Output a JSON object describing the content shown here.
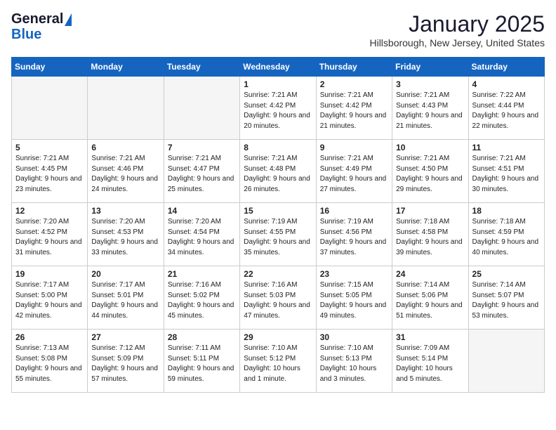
{
  "header": {
    "logo_line1": "General",
    "logo_line2": "Blue",
    "month": "January 2025",
    "location": "Hillsborough, New Jersey, United States"
  },
  "weekdays": [
    "Sunday",
    "Monday",
    "Tuesday",
    "Wednesday",
    "Thursday",
    "Friday",
    "Saturday"
  ],
  "weeks": [
    [
      {
        "day": "",
        "empty": true
      },
      {
        "day": "",
        "empty": true
      },
      {
        "day": "",
        "empty": true
      },
      {
        "day": "1",
        "sunrise": "7:21 AM",
        "sunset": "4:42 PM",
        "daylight": "9 hours and 20 minutes."
      },
      {
        "day": "2",
        "sunrise": "7:21 AM",
        "sunset": "4:42 PM",
        "daylight": "9 hours and 21 minutes."
      },
      {
        "day": "3",
        "sunrise": "7:21 AM",
        "sunset": "4:43 PM",
        "daylight": "9 hours and 21 minutes."
      },
      {
        "day": "4",
        "sunrise": "7:22 AM",
        "sunset": "4:44 PM",
        "daylight": "9 hours and 22 minutes."
      }
    ],
    [
      {
        "day": "5",
        "sunrise": "7:21 AM",
        "sunset": "4:45 PM",
        "daylight": "9 hours and 23 minutes."
      },
      {
        "day": "6",
        "sunrise": "7:21 AM",
        "sunset": "4:46 PM",
        "daylight": "9 hours and 24 minutes."
      },
      {
        "day": "7",
        "sunrise": "7:21 AM",
        "sunset": "4:47 PM",
        "daylight": "9 hours and 25 minutes."
      },
      {
        "day": "8",
        "sunrise": "7:21 AM",
        "sunset": "4:48 PM",
        "daylight": "9 hours and 26 minutes."
      },
      {
        "day": "9",
        "sunrise": "7:21 AM",
        "sunset": "4:49 PM",
        "daylight": "9 hours and 27 minutes."
      },
      {
        "day": "10",
        "sunrise": "7:21 AM",
        "sunset": "4:50 PM",
        "daylight": "9 hours and 29 minutes."
      },
      {
        "day": "11",
        "sunrise": "7:21 AM",
        "sunset": "4:51 PM",
        "daylight": "9 hours and 30 minutes."
      }
    ],
    [
      {
        "day": "12",
        "sunrise": "7:20 AM",
        "sunset": "4:52 PM",
        "daylight": "9 hours and 31 minutes."
      },
      {
        "day": "13",
        "sunrise": "7:20 AM",
        "sunset": "4:53 PM",
        "daylight": "9 hours and 33 minutes."
      },
      {
        "day": "14",
        "sunrise": "7:20 AM",
        "sunset": "4:54 PM",
        "daylight": "9 hours and 34 minutes."
      },
      {
        "day": "15",
        "sunrise": "7:19 AM",
        "sunset": "4:55 PM",
        "daylight": "9 hours and 35 minutes."
      },
      {
        "day": "16",
        "sunrise": "7:19 AM",
        "sunset": "4:56 PM",
        "daylight": "9 hours and 37 minutes."
      },
      {
        "day": "17",
        "sunrise": "7:18 AM",
        "sunset": "4:58 PM",
        "daylight": "9 hours and 39 minutes."
      },
      {
        "day": "18",
        "sunrise": "7:18 AM",
        "sunset": "4:59 PM",
        "daylight": "9 hours and 40 minutes."
      }
    ],
    [
      {
        "day": "19",
        "sunrise": "7:17 AM",
        "sunset": "5:00 PM",
        "daylight": "9 hours and 42 minutes."
      },
      {
        "day": "20",
        "sunrise": "7:17 AM",
        "sunset": "5:01 PM",
        "daylight": "9 hours and 44 minutes."
      },
      {
        "day": "21",
        "sunrise": "7:16 AM",
        "sunset": "5:02 PM",
        "daylight": "9 hours and 45 minutes."
      },
      {
        "day": "22",
        "sunrise": "7:16 AM",
        "sunset": "5:03 PM",
        "daylight": "9 hours and 47 minutes."
      },
      {
        "day": "23",
        "sunrise": "7:15 AM",
        "sunset": "5:05 PM",
        "daylight": "9 hours and 49 minutes."
      },
      {
        "day": "24",
        "sunrise": "7:14 AM",
        "sunset": "5:06 PM",
        "daylight": "9 hours and 51 minutes."
      },
      {
        "day": "25",
        "sunrise": "7:14 AM",
        "sunset": "5:07 PM",
        "daylight": "9 hours and 53 minutes."
      }
    ],
    [
      {
        "day": "26",
        "sunrise": "7:13 AM",
        "sunset": "5:08 PM",
        "daylight": "9 hours and 55 minutes."
      },
      {
        "day": "27",
        "sunrise": "7:12 AM",
        "sunset": "5:09 PM",
        "daylight": "9 hours and 57 minutes."
      },
      {
        "day": "28",
        "sunrise": "7:11 AM",
        "sunset": "5:11 PM",
        "daylight": "9 hours and 59 minutes."
      },
      {
        "day": "29",
        "sunrise": "7:10 AM",
        "sunset": "5:12 PM",
        "daylight": "10 hours and 1 minute."
      },
      {
        "day": "30",
        "sunrise": "7:10 AM",
        "sunset": "5:13 PM",
        "daylight": "10 hours and 3 minutes."
      },
      {
        "day": "31",
        "sunrise": "7:09 AM",
        "sunset": "5:14 PM",
        "daylight": "10 hours and 5 minutes."
      },
      {
        "day": "",
        "empty": true
      }
    ]
  ],
  "labels": {
    "sunrise_prefix": "Sunrise: ",
    "sunset_prefix": "Sunset: ",
    "daylight_prefix": "Daylight: "
  }
}
